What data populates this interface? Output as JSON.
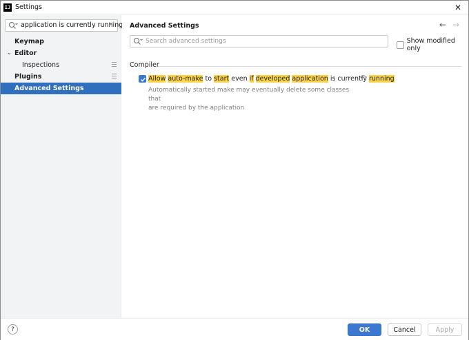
{
  "window": {
    "title": "Settings",
    "app_icon_text": "IJ"
  },
  "sidebar": {
    "search_value": "application is currently running",
    "items": [
      {
        "label": "Keymap"
      },
      {
        "label": "Editor"
      },
      {
        "label": "Inspections"
      },
      {
        "label": "Plugins"
      },
      {
        "label": "Advanced Settings"
      }
    ]
  },
  "main": {
    "title": "Advanced Settings",
    "search_placeholder": "Search advanced settings",
    "show_modified_label": "Show modified only",
    "group_label": "Compiler",
    "option": {
      "checked": true,
      "words": [
        "Allow",
        "auto-make",
        "to",
        "start",
        "even",
        "if",
        "developed",
        "application",
        "is currently",
        "running"
      ],
      "description_line1": "Automatically started make may eventually delete some classes that",
      "description_line2": "are required by the application"
    }
  },
  "footer": {
    "help_label": "?",
    "ok_label": "OK",
    "cancel_label": "Cancel",
    "apply_label": "Apply"
  },
  "colors": {
    "accent": "#3c78d0",
    "highlight": "#fbd44a",
    "selected": "#2f6fbd"
  }
}
